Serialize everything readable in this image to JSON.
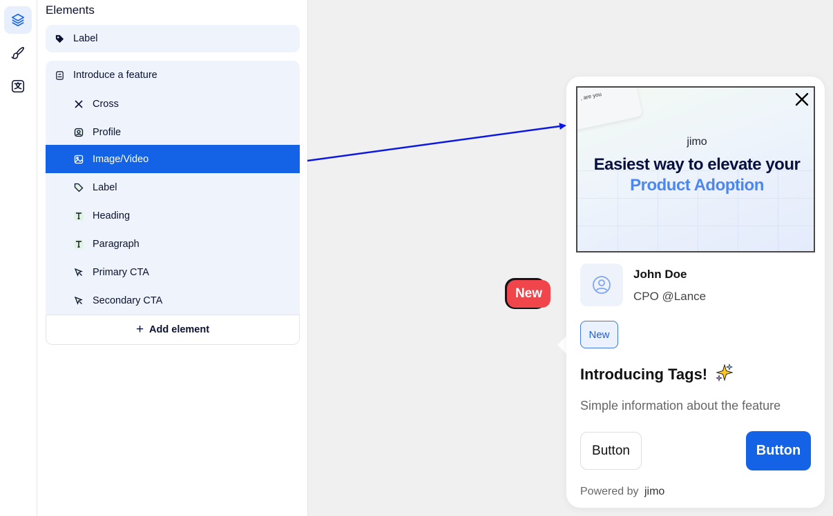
{
  "panel": {
    "title": "Elements",
    "label_card": {
      "label": "Label"
    },
    "group": {
      "label": "Introduce a feature",
      "items": [
        {
          "label": "Cross",
          "icon": "cross-icon"
        },
        {
          "label": "Profile",
          "icon": "profile-icon"
        },
        {
          "label": "Image/Video",
          "icon": "image-icon",
          "selected": true
        },
        {
          "label": "Label",
          "icon": "tag-icon"
        },
        {
          "label": "Heading",
          "icon": "text-icon"
        },
        {
          "label": "Paragraph",
          "icon": "text-icon"
        },
        {
          "label": "Primary CTA",
          "icon": "cursor-icon"
        },
        {
          "label": "Secondary CTA",
          "icon": "cursor-icon"
        }
      ],
      "add_label": "Add element"
    }
  },
  "rail": {
    "icons": [
      "layers-icon",
      "brush-icon",
      "translate-icon"
    ]
  },
  "hotspot": {
    "label": "New"
  },
  "tour": {
    "media": {
      "corner_text": ", are you",
      "brand": "jimo",
      "headline_1": "Easiest way to elevate your",
      "headline_2": "Product Adoption"
    },
    "profile": {
      "name": "John Doe",
      "role": "CPO @Lance"
    },
    "tag": "New",
    "heading": "Introducing Tags!",
    "paragraph": "Simple information about the feature",
    "secondary_button": "Button",
    "primary_button": "Button",
    "powered_by": "Powered by",
    "powered_brand": "jimo"
  },
  "colors": {
    "accent": "#1463e6",
    "badge": "#f0454b",
    "arrow": "#0b18e0",
    "panel_card": "#eff3fb"
  }
}
